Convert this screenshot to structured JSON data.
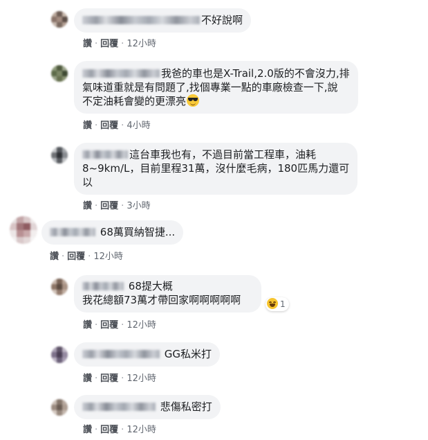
{
  "actions": {
    "like": "讚",
    "reply": "回覆",
    "separator": "·"
  },
  "comments": [
    {
      "lines": [
        "不好說啊"
      ],
      "time": "12小時"
    },
    {
      "lines": [
        "我爸的車也是X-Trail,2.0版的不會沒力,排",
        "氣味道重就是有問題了,找個專業一點的車廠檢查一下,說",
        "不定油耗會變的更漂亮"
      ],
      "emoji": "sunglasses-emoji",
      "time": "4小時"
    },
    {
      "lines": [
        "這台車我也有，不過目前當工程車，油耗",
        "8~9km/L，目前里程31萬，沒什麼毛病，180匹馬力還可",
        "以"
      ],
      "time": "3小時"
    },
    {
      "lines": [
        "68萬買納智捷..."
      ],
      "time": "12小時"
    },
    {
      "lines": [
        "68提大概",
        "我花總額73萬才帶回家啊啊啊啊啊"
      ],
      "reaction": {
        "icon": "haha-emoji",
        "count": "1"
      },
      "time": "12小時"
    },
    {
      "lines": [
        "GG私米打"
      ],
      "time": "12小時"
    },
    {
      "lines": [
        "悲傷私密打"
      ],
      "time": "12小時"
    }
  ]
}
